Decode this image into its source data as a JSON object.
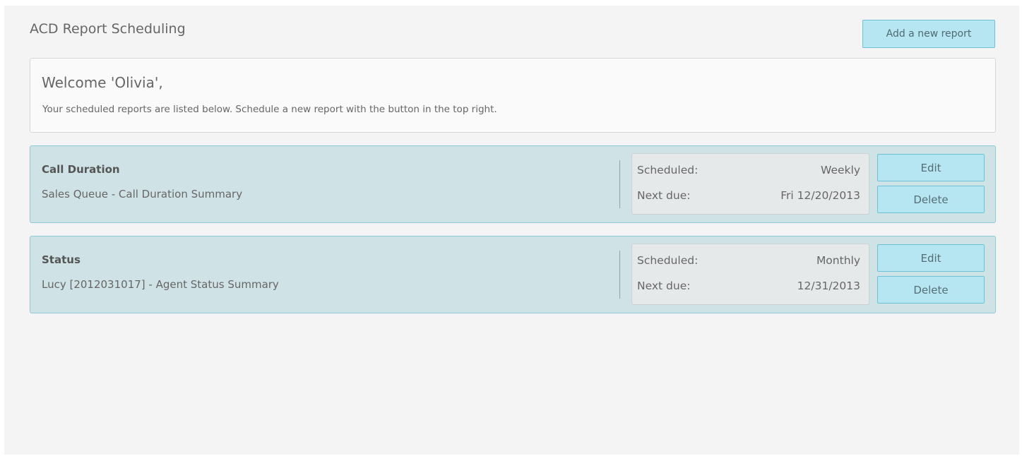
{
  "header": {
    "title": "ACD Report Scheduling",
    "add_button_label": "Add a new report"
  },
  "welcome": {
    "title": "Welcome 'Olivia',",
    "text": "Your scheduled reports are listed below. Schedule a new report with the button in the top right."
  },
  "reports": [
    {
      "title": "Call Duration",
      "description": "Sales Queue - Call Duration Summary",
      "scheduled_label": "Scheduled:",
      "scheduled_value": "Weekly",
      "next_due_label": "Next due:",
      "next_due_value": "Fri 12/20/2013",
      "edit_label": "Edit",
      "delete_label": "Delete"
    },
    {
      "title": "Status",
      "description": "Lucy [2012031017] - Agent Status Summary",
      "scheduled_label": "Scheduled:",
      "scheduled_value": "Monthly",
      "next_due_label": "Next due:",
      "next_due_value": "12/31/2013",
      "edit_label": "Edit",
      "delete_label": "Delete"
    }
  ],
  "colors": {
    "accent": "#b6e6f2",
    "accent_border": "#6cc1d4",
    "card_background": "#cfe2e6"
  }
}
